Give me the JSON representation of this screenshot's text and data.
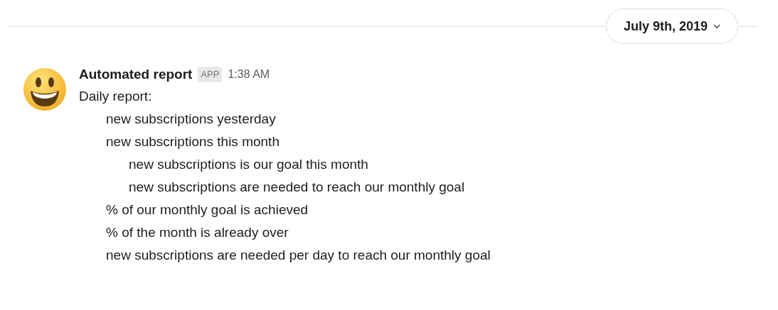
{
  "date_divider": {
    "label": "July 9th, 2019"
  },
  "message": {
    "sender": "Automated report",
    "badge": "APP",
    "time": "1:38 AM",
    "intro": "Daily report:",
    "lines": [
      {
        "kind": "flush",
        "text": "new subscriptions yesterday"
      },
      {
        "kind": "flush",
        "text": "new subscriptions this month"
      },
      {
        "kind": "indented",
        "text": "new subscriptions is our goal this month"
      },
      {
        "kind": "indented",
        "text": "new subscriptions are needed to reach our monthly goal"
      },
      {
        "kind": "flush",
        "text": "% of our monthly goal is achieved"
      },
      {
        "kind": "flush",
        "text": "% of the month is already over"
      },
      {
        "kind": "flush",
        "text": "new subscriptions are needed per day to reach our monthly goal"
      }
    ]
  }
}
